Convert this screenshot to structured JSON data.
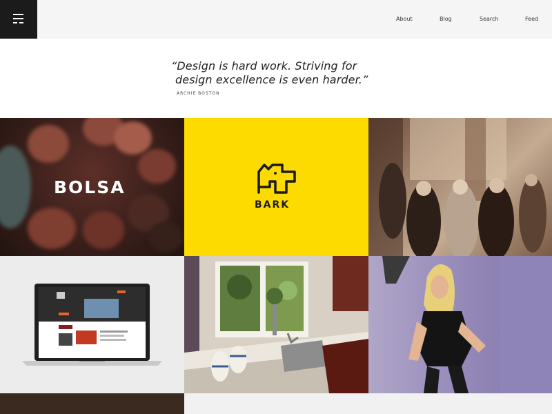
{
  "nav": {
    "about": "About",
    "blog": "Blog",
    "search": "Search",
    "feed": "Feed"
  },
  "quote": {
    "line1": "“Design is hard work. Striving for",
    "line2": "design excellence is even harder.”",
    "author": "ARCHIE BOSTON"
  },
  "tiles": {
    "bolsa": "BOLSA",
    "bark": "BARK"
  },
  "colors": {
    "header_bg": "#f5f5f5",
    "logo_bg": "#1b1b1b",
    "bark_yellow": "#fddb00"
  }
}
